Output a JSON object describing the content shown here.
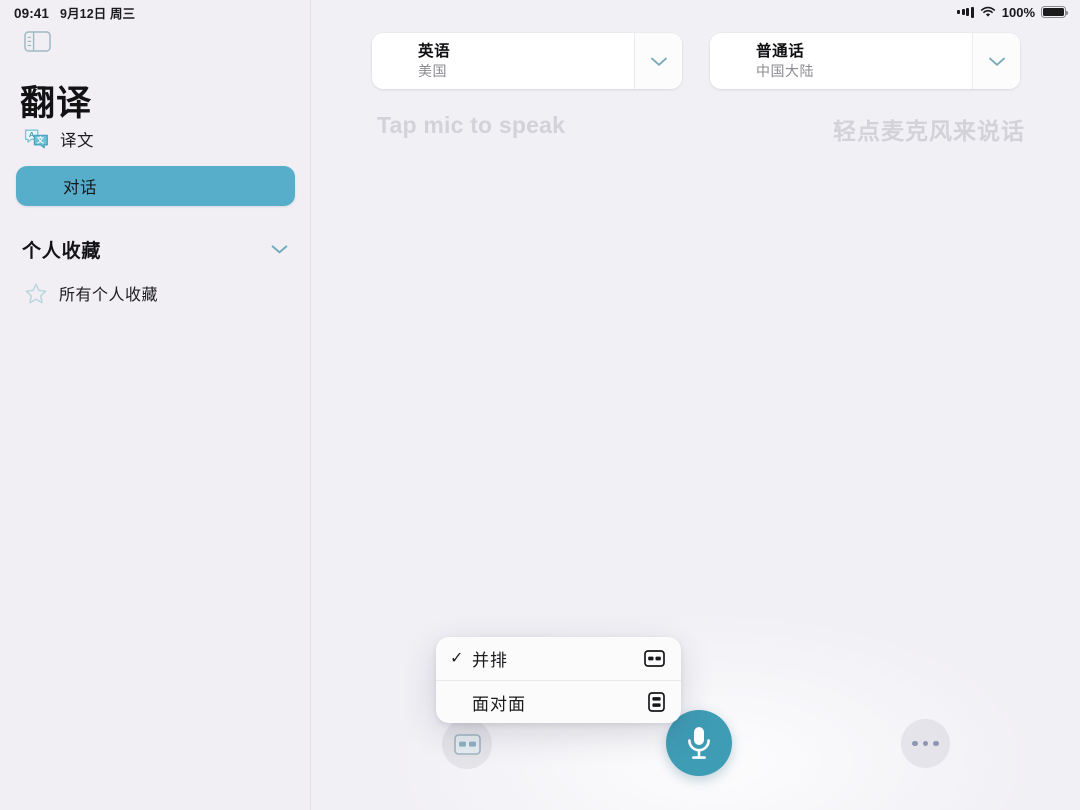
{
  "status_bar": {
    "time": "09:41",
    "date": "9月12日 周三",
    "battery_percent": "100%",
    "signal_icon": "cellular-signal-icon",
    "wifi_icon": "wifi-icon",
    "battery_icon": "battery-icon"
  },
  "sidebar": {
    "toggle_icon": "sidebar-toggle-icon",
    "app_title": "翻译",
    "items": [
      {
        "label": "译文",
        "icon": "translate-bubbles-icon",
        "selected": false
      },
      {
        "label": "对话",
        "icon": "",
        "selected": true
      }
    ],
    "section": {
      "title": "个人收藏",
      "chevron_icon": "chevron-down-icon",
      "items": [
        {
          "label": "所有个人收藏",
          "icon": "star-icon"
        }
      ]
    }
  },
  "main": {
    "source_language": {
      "name": "英语",
      "region": "美国",
      "chevron_icon": "chevron-down-icon"
    },
    "target_language": {
      "name": "普通话",
      "region": "中国大陆",
      "chevron_icon": "chevron-down-icon"
    },
    "prompt_left": "Tap mic to speak",
    "prompt_right": "轻点麦克风来说话"
  },
  "menu": {
    "items": [
      {
        "label": "并排",
        "checked": true,
        "check_glyph": "✓",
        "icon": "side-by-side-layout-icon"
      },
      {
        "label": "面对面",
        "checked": false,
        "check_glyph": "",
        "icon": "face-to-face-layout-icon"
      }
    ]
  },
  "controls": {
    "layout_button": {
      "icon": "side-by-side-layout-icon",
      "active": true
    },
    "mic_button": {
      "icon": "microphone-icon"
    },
    "more_button": {
      "icon": "ellipsis-icon"
    }
  },
  "colors": {
    "accent_teal": "#3f9cb5",
    "selected_pill": "#57aecb",
    "background": "#f1f0f5",
    "placeholder_text": "#d3d2d9"
  }
}
